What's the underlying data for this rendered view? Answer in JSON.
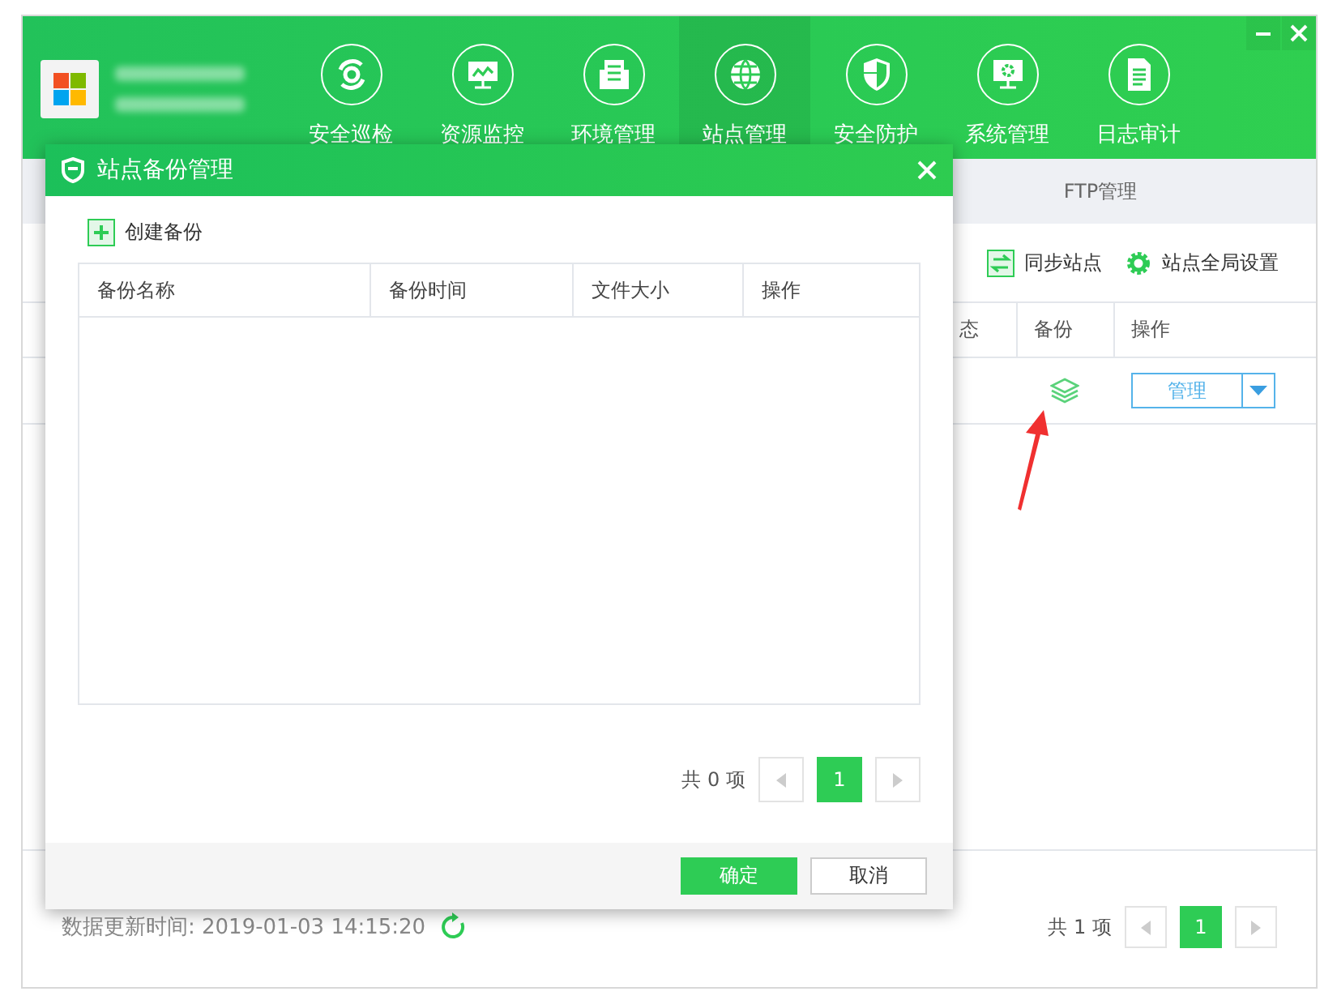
{
  "header": {
    "nav": [
      {
        "label": "安全巡检",
        "selected": false
      },
      {
        "label": "资源监控",
        "selected": false
      },
      {
        "label": "环境管理",
        "selected": false
      },
      {
        "label": "站点管理",
        "selected": true
      },
      {
        "label": "安全防护",
        "selected": false
      },
      {
        "label": "系统管理",
        "selected": false
      },
      {
        "label": "日志审计",
        "selected": false
      }
    ]
  },
  "tabs": [
    {
      "label": "FTP管理",
      "selected": false
    }
  ],
  "toolbar": {
    "buttons": [
      "同步站点",
      "站点全局设置"
    ]
  },
  "table": {
    "columns": [
      "态",
      "备份",
      "操作"
    ],
    "rows": [
      {
        "action": "管理"
      }
    ]
  },
  "status_bar": {
    "updated": "数据更新时间: 2019-01-03 14:15:20"
  },
  "pagination": {
    "total": "共 1 项",
    "pages": [
      {
        "label": "1",
        "selected": true
      }
    ]
  },
  "dialog": {
    "title": "站点备份管理",
    "create_button": "创建备份",
    "table": {
      "columns": [
        "备份名称",
        "备份时间",
        "文件大小",
        "操作"
      ]
    },
    "pagination": {
      "total": "共 0 项",
      "pages": [
        {
          "label": "1",
          "selected": true
        }
      ]
    },
    "buttons": [
      {
        "label": "确定",
        "kind": "primary"
      },
      {
        "label": "取消",
        "kind": "secondary"
      }
    ]
  }
}
